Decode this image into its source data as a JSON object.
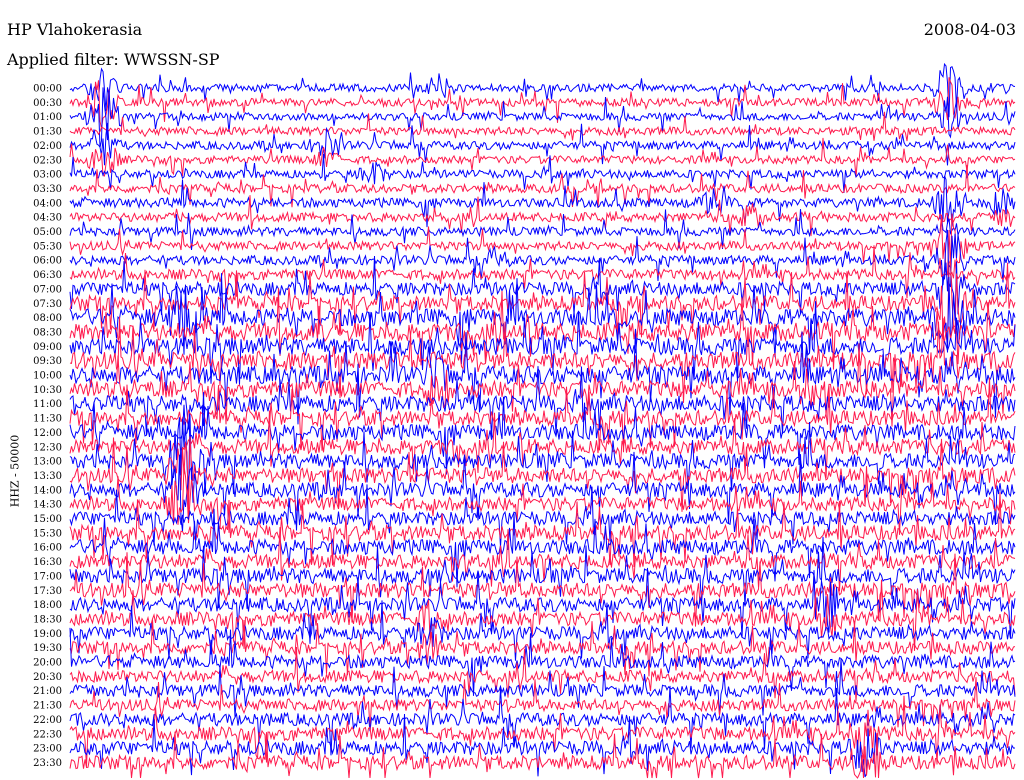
{
  "header": {
    "station": "HP Vlahokerasia",
    "date": "2008-04-03",
    "filter": "Applied filter: WWSSN-SP"
  },
  "channel_label": "HHZ - 50000",
  "chart_data": {
    "type": "line",
    "title": "HP Vlahokerasia",
    "subtitle": "Applied filter: WWSSN-SP",
    "ylabel": "HHZ - 50000",
    "row_labels": [
      "00:00",
      "00:30",
      "01:00",
      "01:30",
      "02:00",
      "02:30",
      "03:00",
      "03:30",
      "04:00",
      "04:30",
      "05:00",
      "05:30",
      "06:00",
      "06:30",
      "07:00",
      "07:30",
      "08:00",
      "08:30",
      "09:00",
      "09:30",
      "10:00",
      "10:30",
      "11:00",
      "11:30",
      "12:00",
      "12:30",
      "13:00",
      "13:30",
      "14:00",
      "14:30",
      "15:00",
      "15:30",
      "16:00",
      "16:30",
      "17:00",
      "17:30",
      "18:00",
      "18:30",
      "19:00",
      "19:30",
      "20:00",
      "20:30",
      "21:00",
      "21:30",
      "22:00",
      "22:30",
      "23:00",
      "23:30"
    ],
    "series_colors": [
      "#0000ff",
      "#ff1a4d"
    ],
    "grid": false,
    "legend": "none",
    "noise_level": [
      0.15,
      0.15,
      0.14,
      0.15,
      0.16,
      0.14,
      0.16,
      0.18,
      0.2,
      0.2,
      0.18,
      0.18,
      0.2,
      0.25,
      0.38,
      0.45,
      0.55,
      0.58,
      0.55,
      0.55,
      0.55,
      0.5,
      0.5,
      0.45,
      0.48,
      0.45,
      0.45,
      0.45,
      0.42,
      0.38,
      0.4,
      0.45,
      0.45,
      0.42,
      0.45,
      0.45,
      0.4,
      0.4,
      0.38,
      0.35,
      0.35,
      0.33,
      0.33,
      0.3,
      0.35,
      0.38,
      0.4,
      0.4
    ]
  }
}
